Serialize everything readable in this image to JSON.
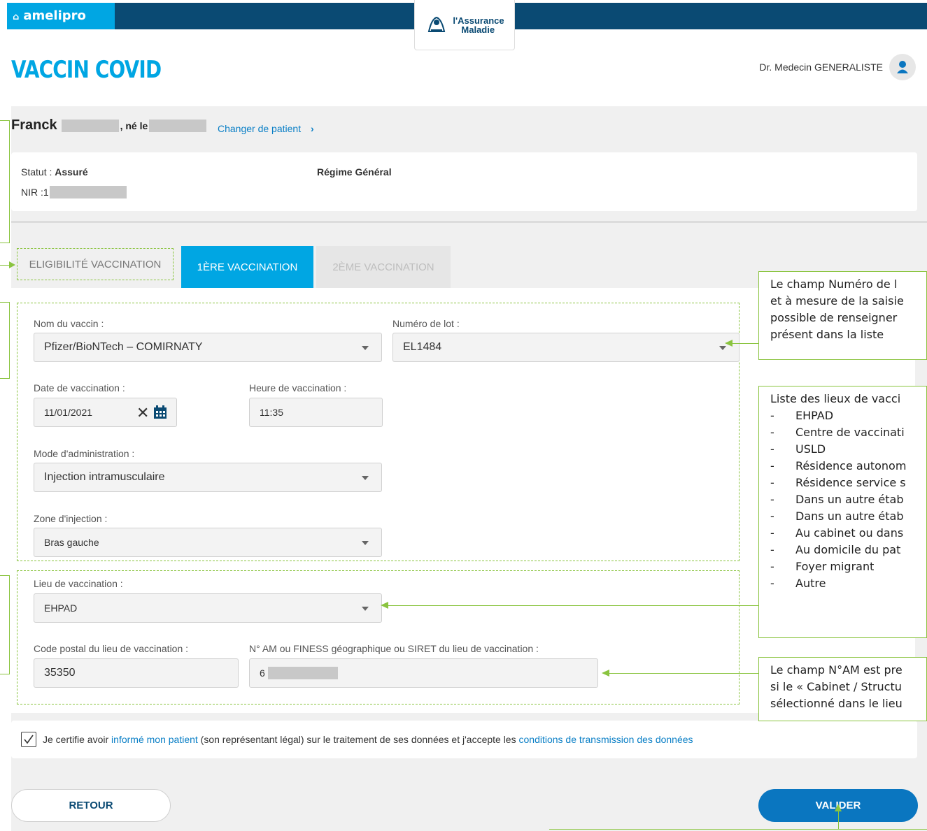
{
  "header": {
    "brand": "amelipro",
    "logo_text_1": "l'Assurance",
    "logo_text_2": "Maladie",
    "title": "VACCIN COVID",
    "doctor": "Dr. Medecin GENERALISTE"
  },
  "patient": {
    "first_name": "Franck",
    "born_label": ", né le",
    "change_link": "Changer de patient",
    "status_label": "Statut : ",
    "status_value": "Assuré",
    "nir_label": "NIR : ",
    "nir_value": "1",
    "regime": "Régime Général"
  },
  "tabs": [
    {
      "label": "ELIGIBILITÉ VACCINATION",
      "state": "outlined"
    },
    {
      "label": "1ÈRE VACCINATION",
      "state": "active"
    },
    {
      "label": "2ÈME VACCINATION",
      "state": "disabled"
    }
  ],
  "form": {
    "vaccine_label": "Nom du vaccin :",
    "vaccine_value": "Pfizer/BioNTech – COMIRNATY",
    "lot_label": "Numéro de lot :",
    "lot_value": "EL1484",
    "date_label": "Date de vaccination :",
    "date_value": "11/01/2021",
    "time_label": "Heure de vaccination :",
    "time_value": "11:35",
    "mode_label": "Mode d'administration :",
    "mode_value": "Injection intramusculaire",
    "zone_label": "Zone d'injection :",
    "zone_value": "Bras gauche",
    "lieu_label": "Lieu de vaccination :",
    "lieu_value": "EHPAD",
    "cp_label": "Code postal du lieu de vaccination :",
    "cp_value": "35350",
    "am_label": "N° AM ou FINESS géographique ou SIRET du lieu de vaccination :",
    "am_value": "6"
  },
  "consent": {
    "text_1": "Je certifie avoir ",
    "link_1": "informé mon patient",
    "text_2": " (son représentant légal) sur le traitement de ses données et j'accepte les ",
    "link_2": "conditions de transmission des données"
  },
  "buttons": {
    "retour": "RETOUR",
    "valider": "VALIDER"
  },
  "callouts": {
    "lot": [
      "Le champ Numéro de l",
      "et à mesure de la saisie",
      "possible de renseigner",
      "présent dans la liste"
    ],
    "lieux_title": "Liste des lieux de vacci",
    "lieux": [
      "EHPAD",
      "Centre de vaccinati",
      "USLD",
      "Résidence autonom",
      "Résidence service s",
      "Dans un autre étab",
      "Dans un autre étab",
      "Au cabinet ou dans",
      "Au domicile du pat",
      "Foyer migrant",
      "Autre"
    ],
    "nam": [
      "Le champ N°AM est pre",
      "si le « Cabinet / Structu",
      "sélectionné dans le lieu"
    ]
  },
  "colors": {
    "brand_blue": "#00a6e3",
    "navy": "#0a4a73",
    "annotation_green": "#8ac43f",
    "primary_button": "#0a76c0"
  }
}
